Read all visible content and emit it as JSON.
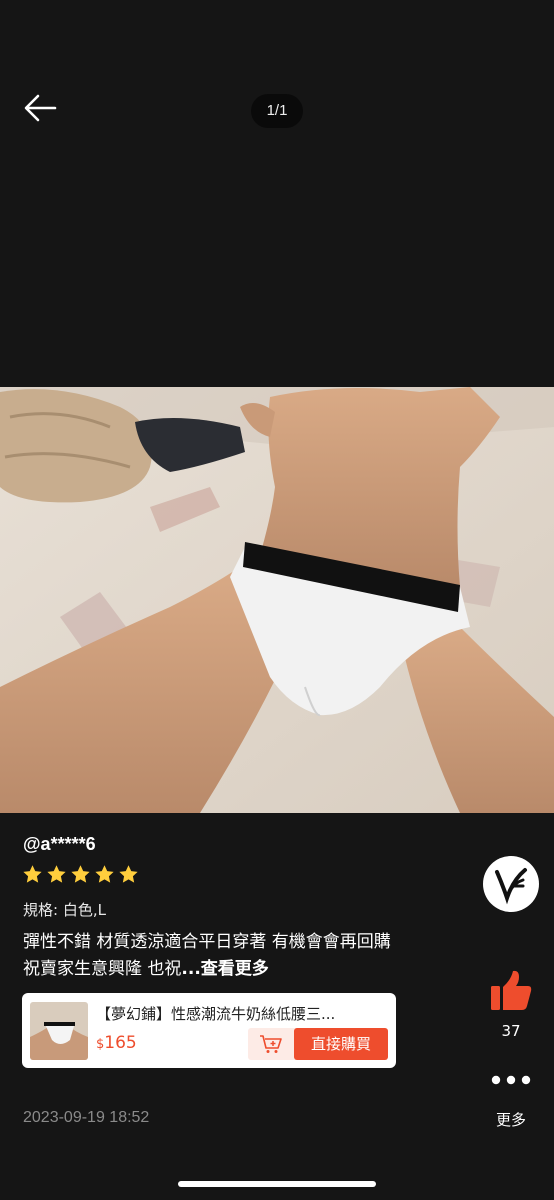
{
  "viewer": {
    "counter": "1/1"
  },
  "review": {
    "username": "@a*****6",
    "rating": 5,
    "spec": "規格: 白色,L",
    "text": "彈性不錯 材質透涼適合平日穿著 有機會會再回購 祝賣家生意興隆 也祝",
    "more_link": "...查看更多",
    "date": "2023-09-19 18:52"
  },
  "product": {
    "title": "【夢幻鋪】性感潮流牛奶絲低腰三...",
    "currency": "$",
    "price": "165",
    "buy_label": "直接購買"
  },
  "actions": {
    "like_count": "37",
    "more_label": "更多"
  },
  "icons": {
    "back": "back-arrow-icon",
    "star": "star-icon",
    "cart": "add-to-cart-icon",
    "like": "thumbs-up-icon",
    "more": "more-dots-icon",
    "shop": "shop-logo-icon"
  },
  "colors": {
    "accent": "#ee4d2d",
    "star": "#ffce3d",
    "like": "#ee4d2d"
  }
}
